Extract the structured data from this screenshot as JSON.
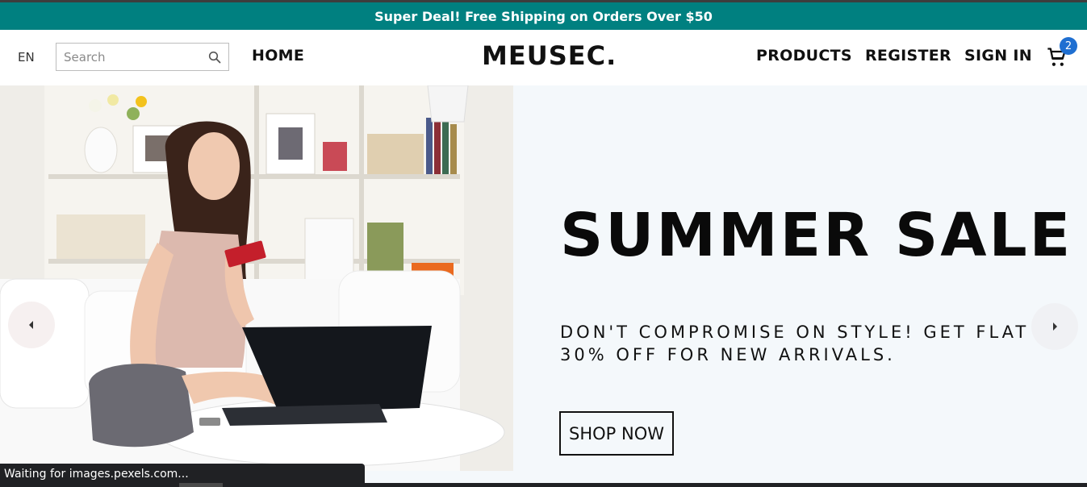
{
  "announcement": {
    "text": "Super Deal! Free Shipping on Orders Over $50"
  },
  "header": {
    "language": "EN",
    "search": {
      "placeholder": "Search",
      "value": ""
    },
    "nav_left": [
      {
        "label": "HOME"
      }
    ],
    "logo": "MEUSEC.",
    "nav_right": [
      {
        "label": "PRODUCTS"
      },
      {
        "label": "REGISTER"
      },
      {
        "label": "SIGN IN"
      }
    ],
    "cart": {
      "count": "2",
      "icon": "cart-icon"
    }
  },
  "hero": {
    "title": "SUMMER SALE",
    "subtitle": "DON'T COMPROMISE ON STYLE! GET FLAT 30% OFF FOR NEW ARRIVALS.",
    "cta_label": "SHOP NOW",
    "image_alt": "woman-shopping-online-photo"
  },
  "status_bar": {
    "text": "Waiting for images.pexels.com..."
  },
  "colors": {
    "announcement_bg": "#008080",
    "badge": "#1f6fd1",
    "hero_bg": "#f4f8fb"
  }
}
